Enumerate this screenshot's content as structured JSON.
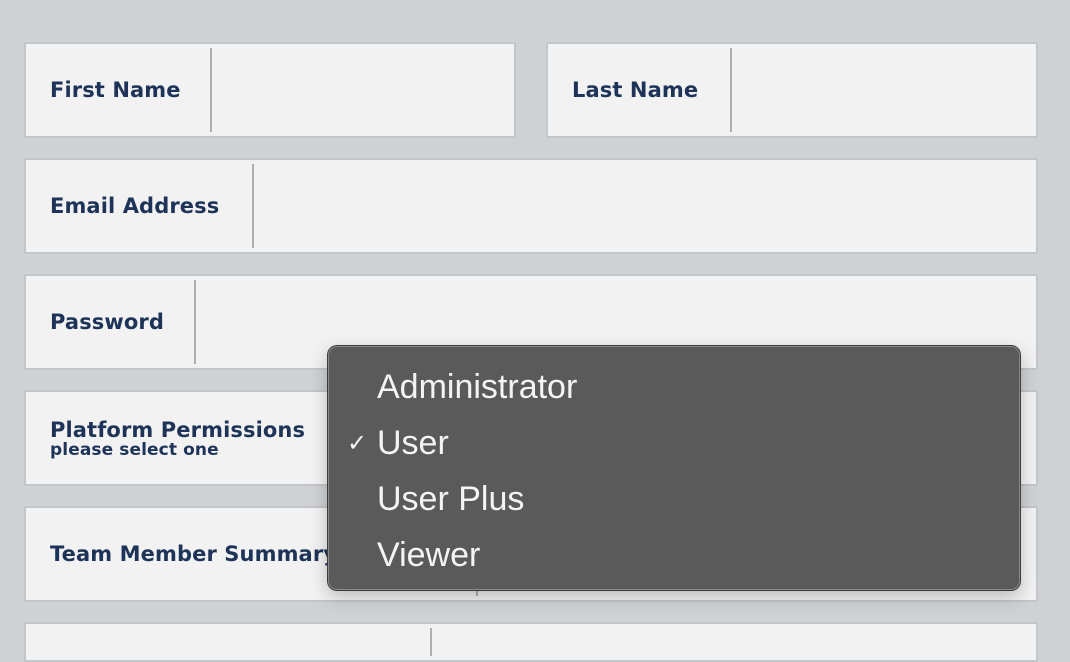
{
  "form": {
    "first_name": {
      "label": "First Name",
      "value": ""
    },
    "last_name": {
      "label": "Last Name",
      "value": ""
    },
    "email": {
      "label": "Email Address",
      "value": ""
    },
    "password": {
      "label": "Password",
      "value": ""
    },
    "platform_permissions": {
      "label": "Platform Permissions",
      "sublabel": "please select one",
      "selected": "User"
    },
    "team_member_summary": {
      "label": "Team Member Summary"
    }
  },
  "permissions_menu": {
    "options": [
      {
        "label": "Administrator",
        "checked": false,
        "check_mark": ""
      },
      {
        "label": "User",
        "checked": true,
        "check_mark": "✓"
      },
      {
        "label": "User Plus",
        "checked": false,
        "check_mark": ""
      },
      {
        "label": "Viewer",
        "checked": false,
        "check_mark": ""
      }
    ]
  },
  "colors": {
    "page_background": "#cfd2d5",
    "field_background": "#f2f2f2",
    "label_text": "#1e3358",
    "menu_background": "#5a5a5a",
    "menu_text": "#f4f4f4"
  }
}
